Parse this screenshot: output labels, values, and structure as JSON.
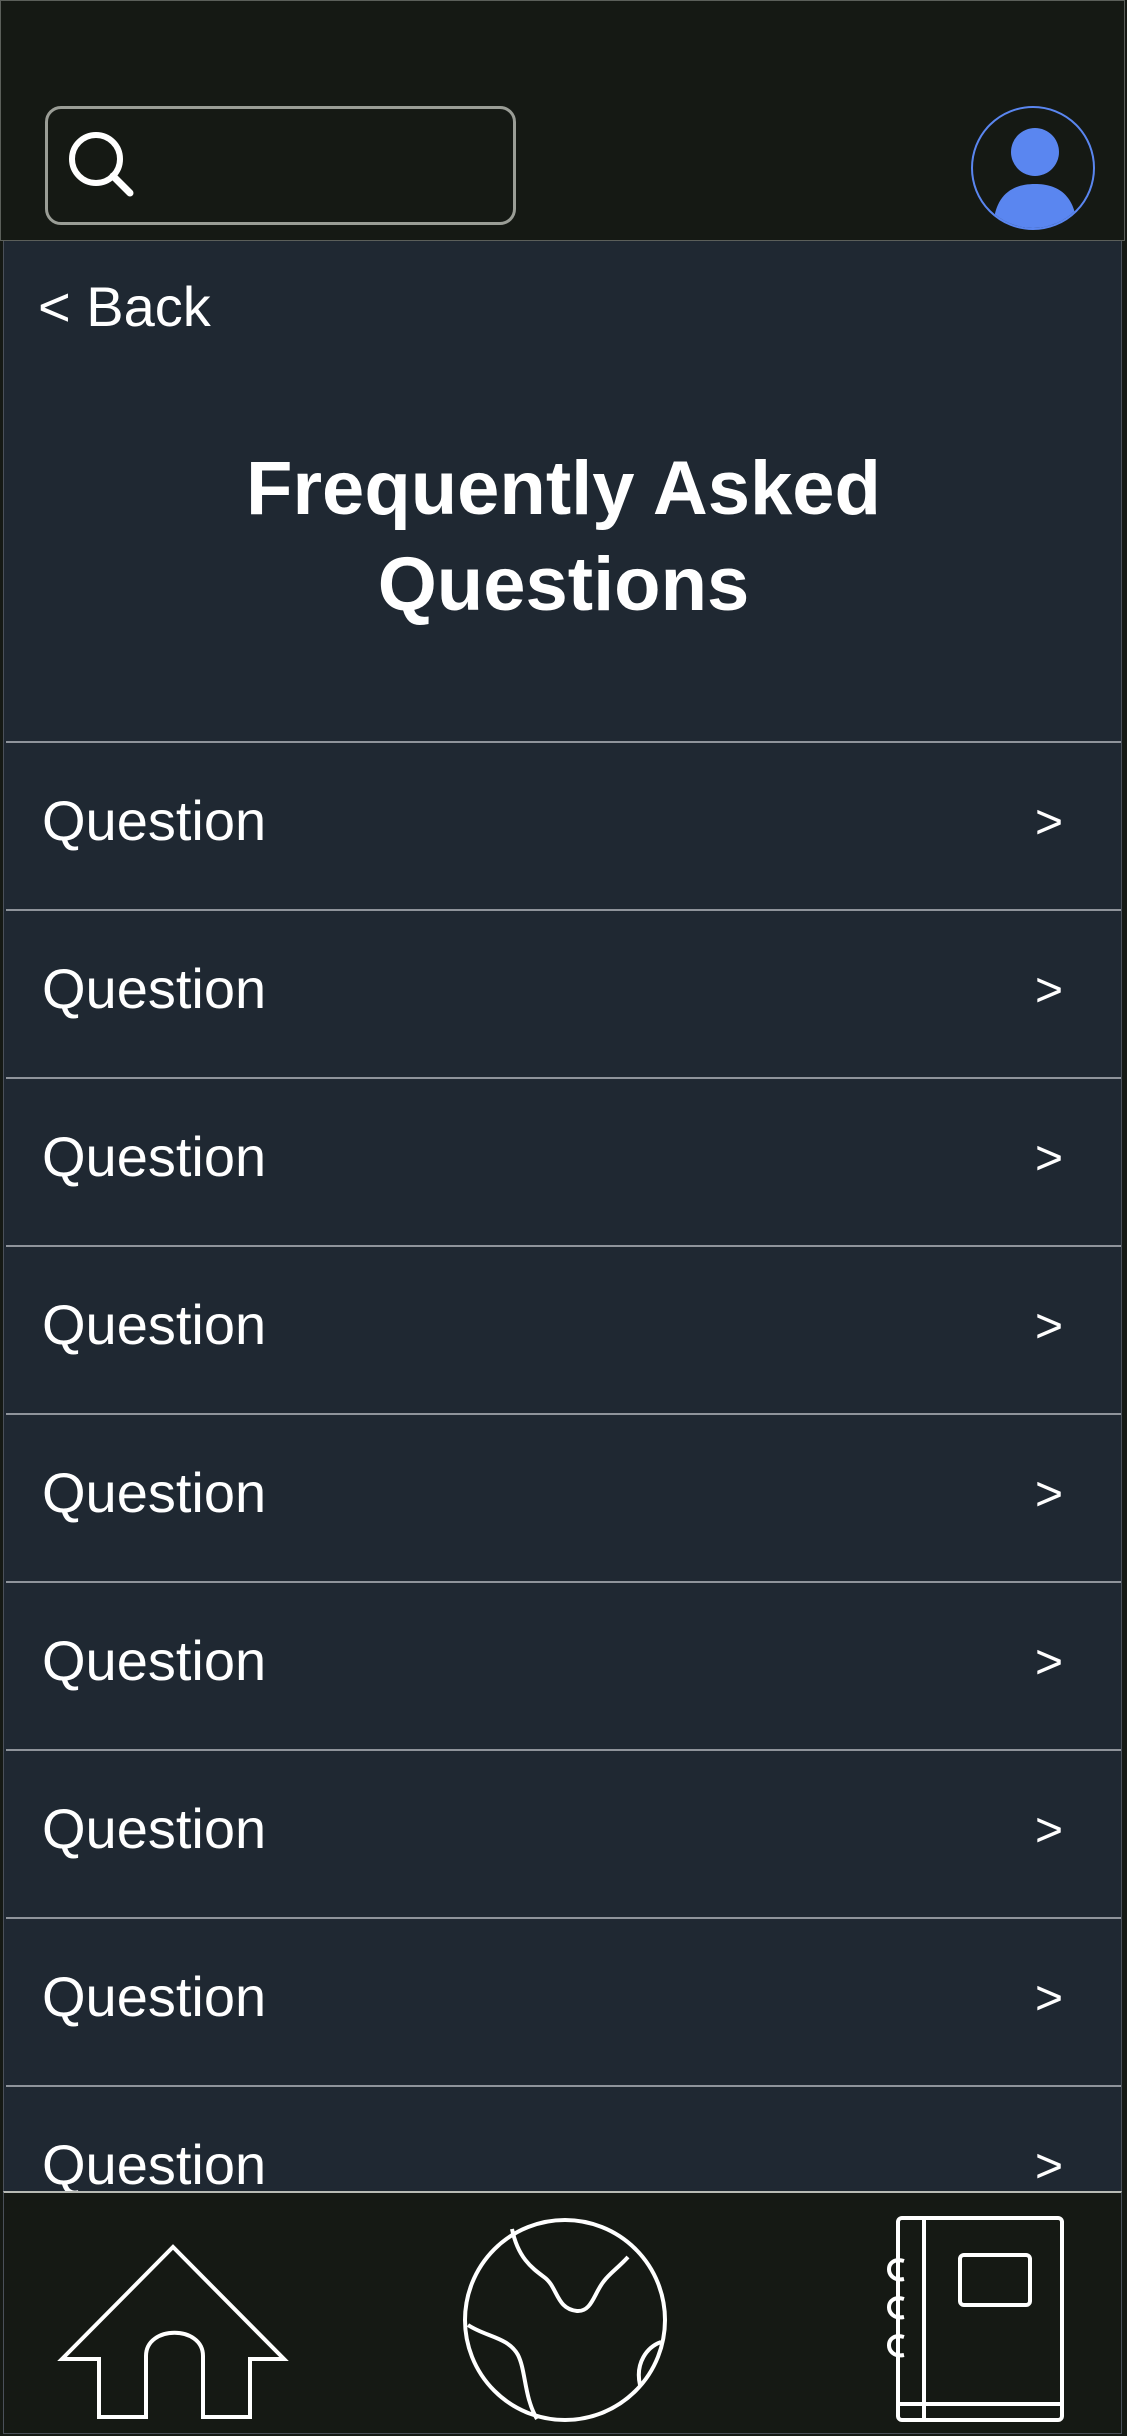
{
  "header": {
    "search": {
      "icon": "search-icon",
      "placeholder": "",
      "value": ""
    },
    "avatar": {
      "icon": "user-icon",
      "color": "#5a86f0"
    }
  },
  "main": {
    "back_label": "< Back",
    "title_line1": "Frequently Asked",
    "title_line2": "Questions",
    "questions": [
      {
        "label": "Question",
        "chevron": ">"
      },
      {
        "label": "Question",
        "chevron": ">"
      },
      {
        "label": "Question",
        "chevron": ">"
      },
      {
        "label": "Question",
        "chevron": ">"
      },
      {
        "label": "Question",
        "chevron": ">"
      },
      {
        "label": "Question",
        "chevron": ">"
      },
      {
        "label": "Question",
        "chevron": ">"
      },
      {
        "label": "Question",
        "chevron": ">"
      },
      {
        "label": "Question",
        "chevron": ">"
      }
    ]
  },
  "bottom_nav": {
    "items": [
      {
        "icon": "home-icon"
      },
      {
        "icon": "globe-icon"
      },
      {
        "icon": "notebook-icon"
      }
    ]
  },
  "colors": {
    "header_bg": "#151914",
    "content_bg": "#1f2832",
    "divider": "#8f949b",
    "accent": "#5a86f0"
  }
}
